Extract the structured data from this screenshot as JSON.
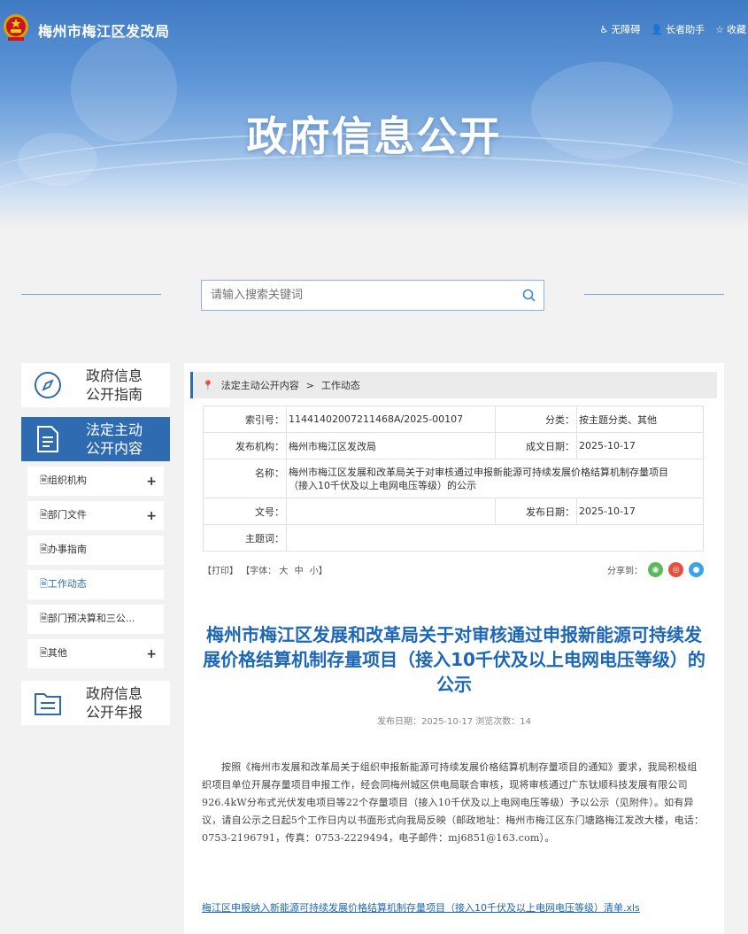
{
  "header": {
    "site_name": "梅州市梅江区发改局",
    "tools": [
      "无障碍",
      "长者助手",
      "收藏"
    ],
    "banner_title": "政府信息公开"
  },
  "search": {
    "placeholder": "请输入搜索关键词"
  },
  "sidebar": {
    "guide": {
      "line1": "政府信息",
      "line2": "公开指南"
    },
    "content": {
      "line1": "法定主动",
      "line2": "公开内容"
    },
    "items": [
      {
        "label": "组织机构",
        "expand": "+"
      },
      {
        "label": "部门文件",
        "expand": "+"
      },
      {
        "label": "办事指南",
        "expand": ""
      },
      {
        "label": "工作动态",
        "expand": ""
      },
      {
        "label": "部门预决算和三公...",
        "expand": ""
      },
      {
        "label": "其他",
        "expand": "+"
      }
    ],
    "annual": {
      "line1": "政府信息",
      "line2": "公开年报"
    }
  },
  "breadcrumb": {
    "level1": "法定主动公开内容",
    "separator": ">",
    "level2": "工作动态"
  },
  "meta": {
    "index_label": "索引号：",
    "index_value": "11441402007211468A/2025-00107",
    "category_label": "分类：",
    "category_value": "按主题分类、其他",
    "publisher_label": "发布机构：",
    "publisher_value": "梅州市梅江区发改局",
    "created_label": "成文日期：",
    "created_value": "2025-10-17",
    "name_label": "名称：",
    "name_value": "梅州市梅江区发展和改革局关于对审核通过申报新能源可持续发展价格结算机制存量项目（接入10千伏及以上电网电压等级）的公示",
    "docno_label": "文号：",
    "docno_value": "",
    "published_label": "发布日期：",
    "published_value": "2025-10-17",
    "keywords_label": "主题词：",
    "keywords_value": ""
  },
  "toolbar": {
    "print": "【打印】",
    "font_label": "【字体：",
    "font_large": "大",
    "font_medium": "中",
    "font_small": "小】",
    "share_label": "分享到："
  },
  "article": {
    "title": "梅州市梅江区发展和改革局关于对审核通过申报新能源可持续发展价格结算机制存量项目（接入10千伏及以上电网电压等级）的公示",
    "meta": "发布日期：2025-10-17  浏览次数：14",
    "body": "按照《梅州市发展和改革局关于组织申报新能源可持续发展价格结算机制存量项目的通知》要求，我局积极组织项目单位开展存量项目申报工作，经会同梅州城区供电局联合审核，现将审核通过广东钛顺科技发展有限公司926.4kW分布式光伏发电项目等22个存量项目（接入10千伏及以上电网电压等级）予以公示（见附件）。如有异议，请自公示之日起5个工作日内以书面形式向我局反映（邮政地址：梅州市梅江区东门塘路梅江发改大楼，电话：0753-2196791，传真：0753-2229494，电子邮件：mj6851@163.com）。",
    "attachment": "梅江区申报纳入新能源可持续发展价格结算机制存量项目（接入10千伏及以上电网电压等级）清单.xls"
  },
  "colors": {
    "brand": "#2f6bb1",
    "title": "#1d67b8"
  }
}
